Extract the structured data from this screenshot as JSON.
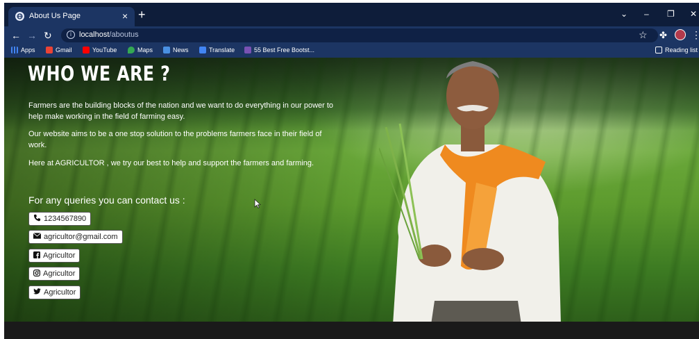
{
  "browser": {
    "tab_title": "About Us Page",
    "tab_close": "×",
    "new_tab": "+",
    "window_controls": {
      "minimize": "–",
      "restore": "❐",
      "close": "✕"
    },
    "url_host": "localhost",
    "url_path": "/aboutus",
    "bookmarks": [
      {
        "label": "Apps",
        "icon": "apps-grid-icon",
        "color": "#4285f4"
      },
      {
        "label": "Gmail",
        "icon": "gmail-icon",
        "color": "#ea4335"
      },
      {
        "label": "YouTube",
        "icon": "youtube-icon",
        "color": "#ff0000"
      },
      {
        "label": "Maps",
        "icon": "maps-icon",
        "color": "#34a853"
      },
      {
        "label": "News",
        "icon": "news-icon",
        "color": "#4a90e2"
      },
      {
        "label": "Translate",
        "icon": "translate-icon",
        "color": "#4285f4"
      },
      {
        "label": "55 Best Free Bootst...",
        "icon": "bootstrap-icon",
        "color": "#7952b3"
      }
    ],
    "reading_list": "Reading list"
  },
  "page": {
    "heading": "WHO WE ARE ?",
    "paragraphs": [
      "Farmers are the building blocks of the nation and we want to do everything in our power to help make working in the field of farming easy.",
      "Our website aims to be a one stop solution to the problems farmers face in their field of work.",
      "Here at AGRICULTOR , we try our best to help and support the farmers and farming."
    ],
    "contact_title": "For any queries you can contact us :",
    "contacts": [
      {
        "icon": "phone-icon",
        "glyph": "📞",
        "label": "1234567890"
      },
      {
        "icon": "envelope-icon",
        "glyph": "✉",
        "label": "agricultor@gmail.com"
      },
      {
        "icon": "facebook-icon",
        "glyph": "f",
        "label": "Agricultor"
      },
      {
        "icon": "instagram-icon",
        "glyph": "◎",
        "label": "Agricultor"
      },
      {
        "icon": "twitter-icon",
        "glyph": "🐦",
        "label": "Agricultor"
      }
    ]
  },
  "colors": {
    "browser_chrome": "#1c3563",
    "tab_strip": "#0e1d3a",
    "heading": "#ffffff",
    "button_bg": "#ffffff"
  }
}
